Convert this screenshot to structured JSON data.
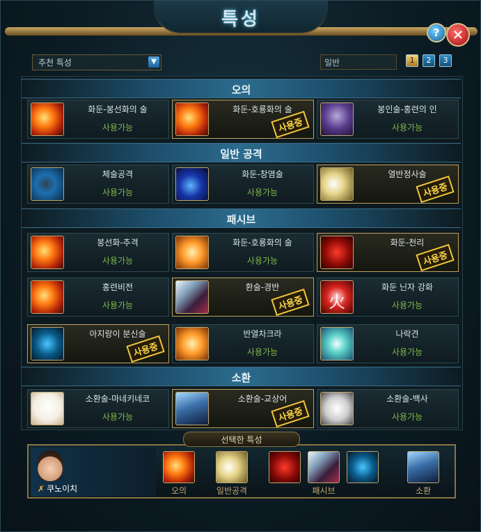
{
  "window": {
    "title": "특성",
    "help_label": "?",
    "close_label": "✕"
  },
  "toolbar": {
    "preset_value": "추천 특성",
    "mode_value": "일반",
    "pages": [
      "1",
      "2",
      "3"
    ],
    "active_page": "1"
  },
  "sections": [
    {
      "title": "오의",
      "slots": [
        {
          "name": "화둔-봉선화의 술",
          "status": "사용가능",
          "icon": "fire-icon",
          "selected": false,
          "stamp": ""
        },
        {
          "name": "화둔-호룡화의 술",
          "status": "",
          "icon": "fire-icon",
          "selected": true,
          "stamp": "사용중"
        },
        {
          "name": "봉인술-홍련의 인",
          "status": "사용가능",
          "icon": "chain-icon",
          "selected": false,
          "stamp": ""
        }
      ]
    },
    {
      "title": "일반 공격",
      "slots": [
        {
          "name": "체술공격",
          "status": "사용가능",
          "icon": "fist-icon",
          "selected": false,
          "stamp": ""
        },
        {
          "name": "화둔-창염술",
          "status": "사용가능",
          "icon": "blue-fire-icon",
          "selected": false,
          "stamp": ""
        },
        {
          "name": "열반정사술",
          "status": "",
          "icon": "wind-icon",
          "selected": true,
          "stamp": "사용중"
        }
      ]
    },
    {
      "title": "패시브",
      "slots": [
        {
          "name": "봉선화-추격",
          "status": "사용가능",
          "icon": "fire-icon",
          "selected": false,
          "stamp": ""
        },
        {
          "name": "화둔-호룡화의 술",
          "status": "사용가능",
          "icon": "fire-icon",
          "selected": false,
          "stamp": ""
        },
        {
          "name": "화둔-천리",
          "status": "",
          "icon": "red-figure-icon",
          "selected": true,
          "stamp": "사용중"
        },
        {
          "name": "홍련비전",
          "status": "사용가능",
          "icon": "fire-icon",
          "selected": false,
          "stamp": ""
        },
        {
          "name": "환술-경반",
          "status": "",
          "icon": "blade-icon",
          "selected": true,
          "stamp": "사용중"
        },
        {
          "name": "화둔 닌자 강화",
          "status": "사용가능",
          "icon": "kanji-fire-icon",
          "selected": false,
          "stamp": ""
        },
        {
          "name": "아지랑이 분신술",
          "status": "",
          "icon": "clone-icon",
          "selected": true,
          "stamp": "사용중"
        },
        {
          "name": "반열차크라",
          "status": "사용가능",
          "icon": "orb-icon",
          "selected": false,
          "stamp": ""
        },
        {
          "name": "나락견",
          "status": "사용가능",
          "icon": "spiral-icon",
          "selected": false,
          "stamp": ""
        }
      ]
    },
    {
      "title": "소환",
      "slots": [
        {
          "name": "소환술-마네키네코",
          "status": "사용가능",
          "icon": "cat-icon",
          "selected": false,
          "stamp": ""
        },
        {
          "name": "소환술-교상어",
          "status": "",
          "icon": "shark-icon",
          "selected": true,
          "stamp": "사용중"
        },
        {
          "name": "소환술-백사",
          "status": "사용가능",
          "icon": "snake-icon",
          "selected": false,
          "stamp": ""
        }
      ]
    }
  ],
  "selected_panel": {
    "title": "선택한 특성",
    "character_name": "쿠노이치",
    "labels": {
      "ougi": "오의",
      "normal": "일반공격",
      "passive": "패시브",
      "summon": "소환"
    }
  }
}
